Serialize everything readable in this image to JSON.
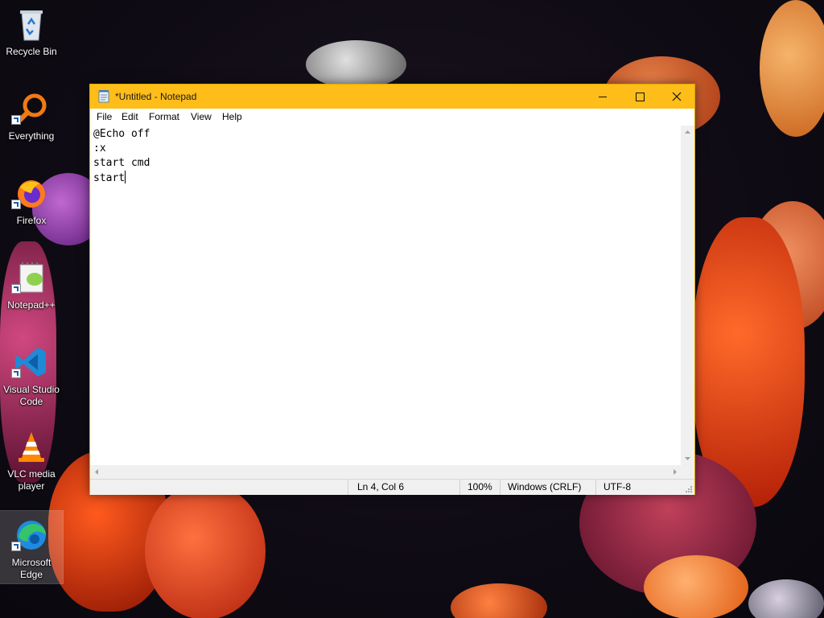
{
  "desktop": {
    "icons": [
      {
        "label": "Recycle Bin"
      },
      {
        "label": "Everything"
      },
      {
        "label": "Firefox"
      },
      {
        "label": "Notepad++"
      },
      {
        "label_line1": "Visual Studio",
        "label_line2": "Code"
      },
      {
        "label_line1": "VLC media",
        "label_line2": "player"
      },
      {
        "label_line1": "Microsoft",
        "label_line2": "Edge"
      }
    ]
  },
  "window": {
    "title": "*Untitled - Notepad",
    "accent_color": "#ffbd1a",
    "caption_buttons": {
      "minimize": "minimize-icon",
      "maximize": "maximize-icon",
      "close": "close-icon"
    },
    "menu": [
      "File",
      "Edit",
      "Format",
      "View",
      "Help"
    ],
    "editor_lines": [
      "@Echo off",
      ":x",
      "start cmd",
      "start"
    ],
    "status": {
      "position": "Ln 4, Col 6",
      "zoom": "100%",
      "line_ending": "Windows (CRLF)",
      "encoding": "UTF-8"
    }
  }
}
